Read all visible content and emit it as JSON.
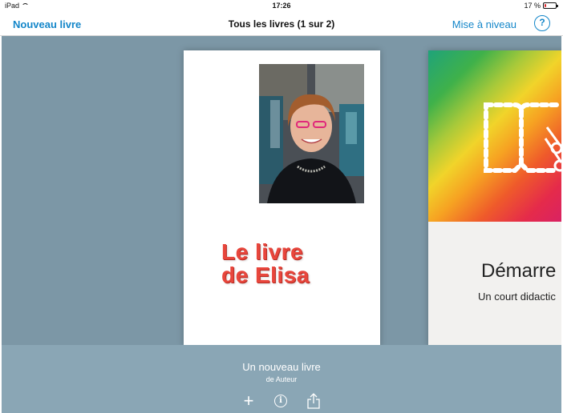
{
  "status": {
    "device": "iPad",
    "time": "17:26",
    "battery": "17 %",
    "battery_level": 0.17
  },
  "nav": {
    "new_book": "Nouveau livre",
    "title": "Tous les livres (1 sur 2)",
    "upgrade": "Mise à niveau",
    "help": "?"
  },
  "books": [
    {
      "title_line1": "Le livre",
      "title_line2": "de Elisa"
    },
    {
      "title": "Démarre",
      "subtitle": "Un court didactic"
    }
  ],
  "selected": {
    "title": "Un nouveau livre",
    "author": "de Auteur"
  },
  "toolbar": {
    "add": "+",
    "info": "i"
  },
  "colors": {
    "accent": "#1386c9",
    "shelf": "#7c97a6",
    "book_title": "#e8463c"
  },
  "icons": [
    "wifi-icon",
    "battery-icon",
    "help-icon",
    "add-icon",
    "info-icon",
    "share-icon",
    "book-logo-icon"
  ]
}
